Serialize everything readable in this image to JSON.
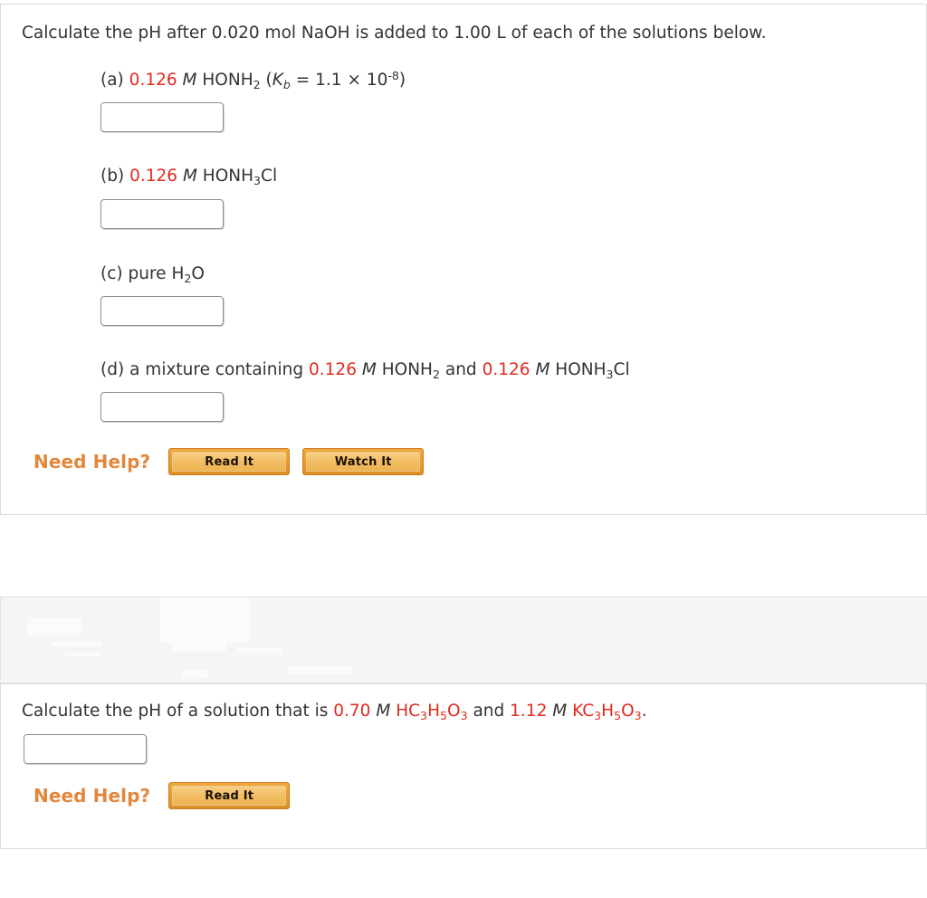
{
  "question_one": {
    "prompt": "Calculate the pH after 0.020 mol NaOH is added to 1.00 L of each of the solutions below.",
    "parts": [
      {
        "label": "(a)",
        "concentration": "0.126",
        "unit": "M",
        "species": "HONH2",
        "constant_prefix": "(K",
        "constant_sub": "b",
        "constant_body": " = 1.1 × 10",
        "constant_exp": "-8",
        "constant_suffix": ")",
        "answer_value": "",
        "answer_placeholder": ""
      },
      {
        "label": "(b)",
        "concentration": "0.126",
        "unit": "M",
        "species": "HONH3Cl",
        "answer_value": "",
        "answer_placeholder": ""
      },
      {
        "label": "(c)",
        "text_plain": "pure",
        "species": "H2O",
        "answer_value": "",
        "answer_placeholder": ""
      },
      {
        "label": "(d)",
        "text_plain": "a mixture containing",
        "concentration": "0.126",
        "unit": "M",
        "species": "HONH2",
        "conjunction": "and",
        "concentration2": "0.126",
        "unit2": "M",
        "species2": "HONH3Cl",
        "answer_value": "",
        "answer_placeholder": ""
      }
    ],
    "help": {
      "label": "Need Help?",
      "buttons": [
        "Read It",
        "Watch It"
      ]
    }
  },
  "question_two": {
    "prompt_start": "Calculate the pH of a solution that is ",
    "concentration1": "0.70",
    "unit1": "M",
    "species1": "HC3H5O3",
    "conjunction": " and ",
    "concentration2": "1.12",
    "unit2": "M",
    "species2": "KC3H5O3",
    "period": ".",
    "answer_value": "",
    "answer_placeholder": "",
    "help": {
      "label": "Need Help?",
      "buttons": [
        "Read It"
      ]
    }
  },
  "colors": {
    "value_red": "#e02b20",
    "help_orange": "#e2873c",
    "button_border": "#c87d1e",
    "text": "#333333",
    "panel_border": "#d9d9d9",
    "band_background": "#f5f5f5"
  }
}
